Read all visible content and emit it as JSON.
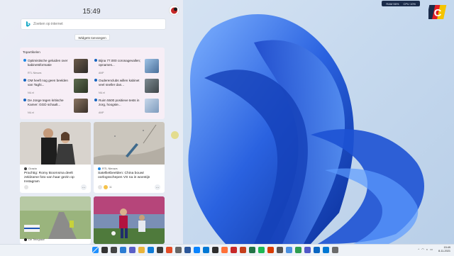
{
  "panel": {
    "clock": "15:49",
    "search_placeholder": "Zoeken op internet",
    "add_widgets_label": "Widgets toevoegen"
  },
  "top_stories": {
    "heading": "Topartikelen",
    "items": [
      {
        "title": "Optimistische geluiden over kabinetsformatie",
        "source": "RTL Nieuws",
        "icon_color": "#1e88e5"
      },
      {
        "title": "Bijna 77.000 coronagevallen; opnames...",
        "source": "ANP",
        "icon_color": "#1565c0"
      },
      {
        "title": "OM heeft nog geen beelden van Taghi...",
        "source": "NU.nl",
        "icon_color": "#1565c0"
      },
      {
        "title": "Ouderenclubs willen kabinet veel sneller dan...",
        "source": "NU.nl",
        "icon_color": "#1565c0"
      },
      {
        "title": "De Jonge tegen kritische Kamer: GGD schaalt...",
        "source": "NU.nl",
        "icon_color": "#1565c0"
      },
      {
        "title": "Ruim 5500 positieve tests in zorg, hoogste...",
        "source": "ANP",
        "icon_color": "#1565c0"
      }
    ]
  },
  "cards": [
    {
      "source": "Grazia",
      "title": "Prachtig: Romy Boomsma deelt zeldzame foto van haar gezin op Instagram",
      "reactions": "",
      "icon": "grazia-icon"
    },
    {
      "source": "RTL Nieuws",
      "title": "Satellietbeelden: China bouwt oorlogsschepen VS na in woestijn",
      "reactions": "11",
      "icon": "rtl-icon"
    },
    {
      "source": "De Telegraaf",
      "title": "",
      "reactions": "",
      "icon": "telegraaf-icon"
    },
    {
      "source": "",
      "title": "",
      "reactions": "",
      "icon": ""
    }
  ],
  "sysmon": {
    "ram": "RAM 56%",
    "cpu": "CPU 10%"
  },
  "taskbar": {
    "time": "15:49",
    "date": "8-11-2021",
    "icons": [
      "start-icon",
      "search-icon",
      "task-view-icon",
      "widgets-icon",
      "chat-icon",
      "explorer-icon",
      "edge-icon",
      "store-icon",
      "chrome-icon",
      "settings-icon",
      "word-icon",
      "photos-icon",
      "mail-icon",
      "terminal-icon",
      "firefox-icon",
      "video-icon",
      "powerpoint-icon",
      "excel-icon",
      "spotify-icon",
      "office-icon",
      "camera-icon",
      "notepad-icon",
      "green-app-icon",
      "teams-icon",
      "onedrive-icon",
      "outlook-icon",
      "calc-icon"
    ]
  },
  "colors": {
    "accent": "#0067c0",
    "bloom_blue": "#1f55d6",
    "bloom_light": "#4d8df2"
  }
}
